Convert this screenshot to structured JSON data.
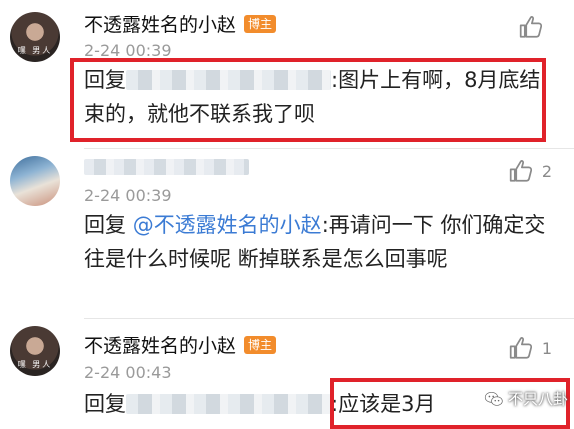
{
  "comments": [
    {
      "username": "不透露姓名的小赵",
      "badge": "博主",
      "avatar_caption": "嘿 男人",
      "time": "2-24 00:39",
      "reply_prefix": "回复",
      "text": ":图片上有啊，8月底结束的，就他不联系我了呗",
      "likes": ""
    },
    {
      "username": "",
      "time": "2-24 00:39",
      "reply_prefix": "回复",
      "mention": "@不透露姓名的小赵",
      "text": ":再请问一下 你们确定交往是什么时候呢 断掉联系是怎么回事呢",
      "likes": "2"
    },
    {
      "username": "不透露姓名的小赵",
      "badge": "博主",
      "avatar_caption": "嘿 男人",
      "time": "2-24 00:43",
      "reply_prefix": "回复",
      "text": ":应该是3月",
      "likes": "1"
    }
  ],
  "watermark": "不只八卦",
  "colors": {
    "highlight": "#e0222a",
    "badge": "#f28c2c",
    "mention": "#3b7bd4"
  },
  "icons": {
    "like": "thumbs-up-icon",
    "watermark": "wechat-icon"
  }
}
